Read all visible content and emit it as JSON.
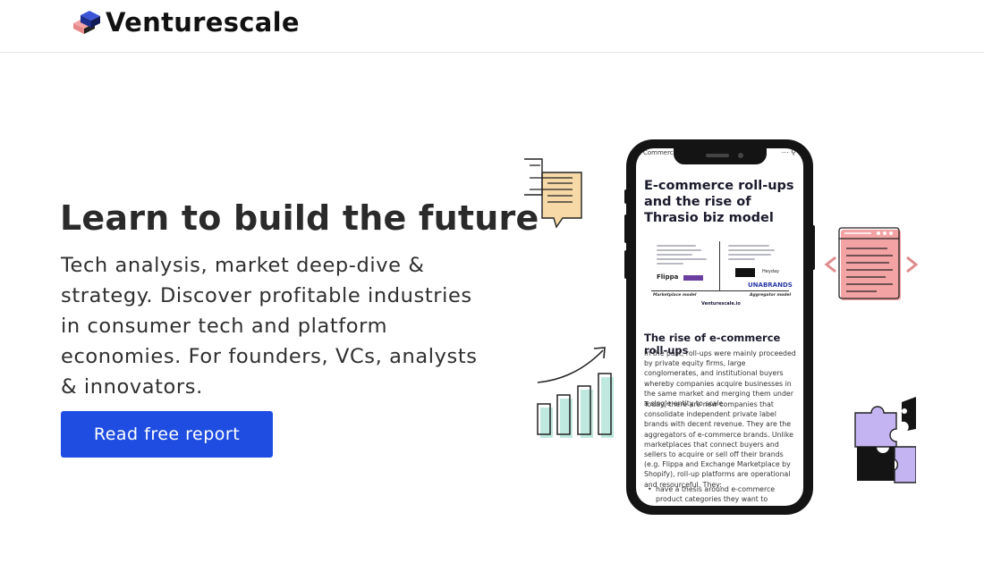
{
  "header": {
    "brand": "Venturescale"
  },
  "hero": {
    "title": "Learn to build the future",
    "description": "Tech analysis, market deep-dive & strategy. Discover profitable industries in consumer tech and platform economies. For founders, VCs, analysts & innovators.",
    "cta_label": "Read free report"
  },
  "phone_screen": {
    "top_bar_text": "Commerc",
    "article_title": "E-commerce roll-ups and the rise of Thrasio biz model",
    "figure": {
      "left_logo": "Flippa",
      "right_logo": "UNABRANDS",
      "heyday": "Heyday",
      "left_label": "Marketplace model",
      "right_label": "Aggregator model",
      "brand": "Venturescale.io"
    },
    "section_heading": "The rise of e-commerce roll-ups",
    "para1": "In the past, roll-ups were mainly proceeded by private equity firms, large conglomerates, and institutional buyers whereby companies acquire businesses in the same market and merging them under a single entity to scale.",
    "para2": "Today, there are new companies that consolidate independent private label brands with decent revenue. They are the aggregators of e-commerce brands. Unlike marketplaces that connect buyers and sellers to acquire or sell off their brands (e.g. Flippa and Exchange Marketplace by Shopify), roll-up platforms are operational and resourceful. They:",
    "bullet1": "have a thesis around e-commerce product categories they want to acquire"
  },
  "colors": {
    "cta": "#1f4de2",
    "chat_yellow": "#f6d9a6",
    "browser_pink": "#f3a3a3",
    "chart_mint": "#bfe9df",
    "puzzle_lavender": "#c4b4f2"
  },
  "icons": [
    "logo-cube-icon",
    "chat-bubble-icon",
    "growth-chart-icon",
    "browser-window-icon",
    "puzzle-icon"
  ]
}
